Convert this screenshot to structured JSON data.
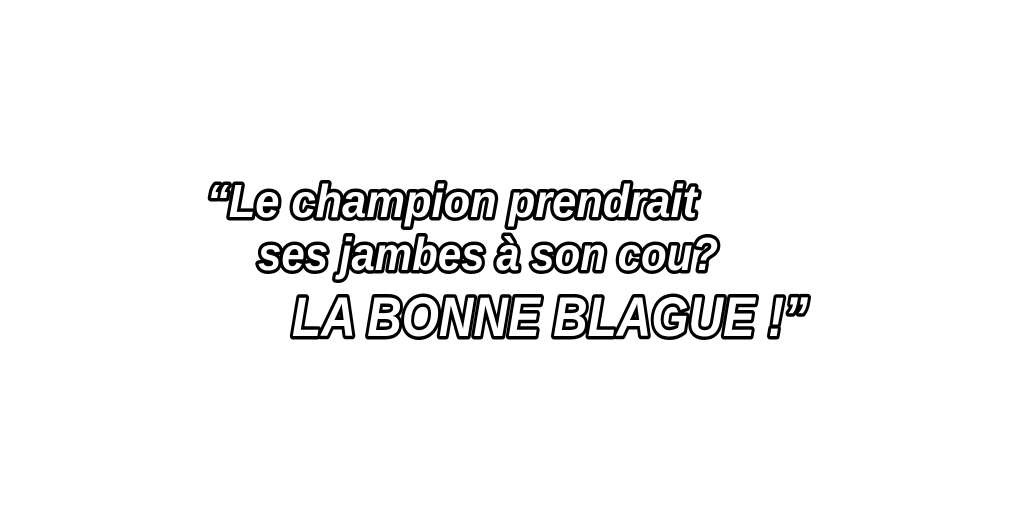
{
  "quote": {
    "line1": "“Le champion prendrait",
    "line2": "ses jambes à son cou?",
    "line3": "LA BONNE BLAGUE !”"
  },
  "colors": {
    "fill": "#ffffff",
    "outline": "#000000",
    "background": "#ffffff"
  }
}
